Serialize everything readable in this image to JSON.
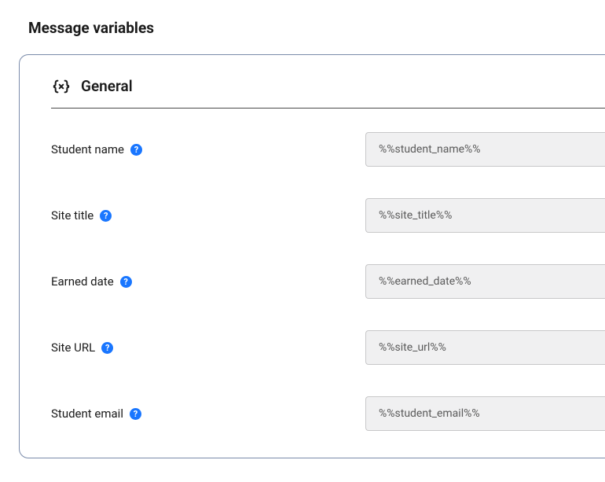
{
  "page": {
    "title": "Message variables"
  },
  "section": {
    "title": "General"
  },
  "variables": [
    {
      "label": "Student name",
      "value": "%%student_name%%"
    },
    {
      "label": "Site title",
      "value": "%%site_title%%"
    },
    {
      "label": "Earned date",
      "value": "%%earned_date%%"
    },
    {
      "label": "Site URL",
      "value": "%%site_url%%"
    },
    {
      "label": "Student email",
      "value": "%%student_email%%"
    }
  ]
}
